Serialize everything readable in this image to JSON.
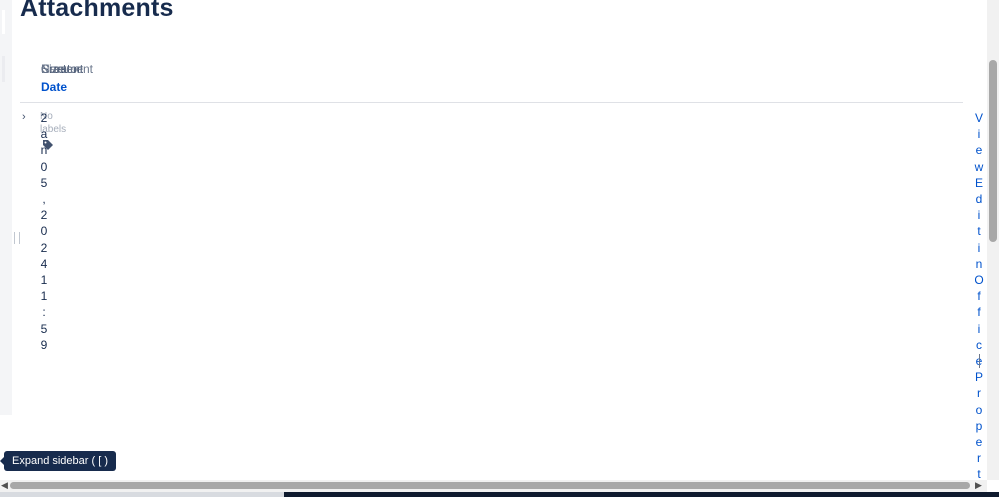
{
  "page": {
    "title": "Attachments"
  },
  "table": {
    "columns": [
      "Size",
      "Creator",
      "Content",
      "Name",
      "Comment"
    ],
    "date_column": "Date",
    "row": {
      "labels_text": "No labels",
      "date_chars": [
        "2",
        "a",
        "n",
        "0",
        "5",
        ",",
        "2",
        "0",
        "2",
        "4",
        "1",
        "1",
        ":",
        "5",
        "9"
      ],
      "actions_chars": [
        "V",
        "i",
        "e",
        "w",
        "E",
        "d",
        "i",
        "t",
        "i",
        "n",
        "O",
        "f",
        "f",
        "i",
        "c",
        "e",
        "P",
        "r",
        "o",
        "p",
        "e",
        "r",
        "t"
      ]
    }
  },
  "sidebar": {
    "expand_tooltip": "Expand sidebar ( [ )"
  },
  "icons": {
    "expand": "chevron-right-icon",
    "label": "tag-icon"
  }
}
